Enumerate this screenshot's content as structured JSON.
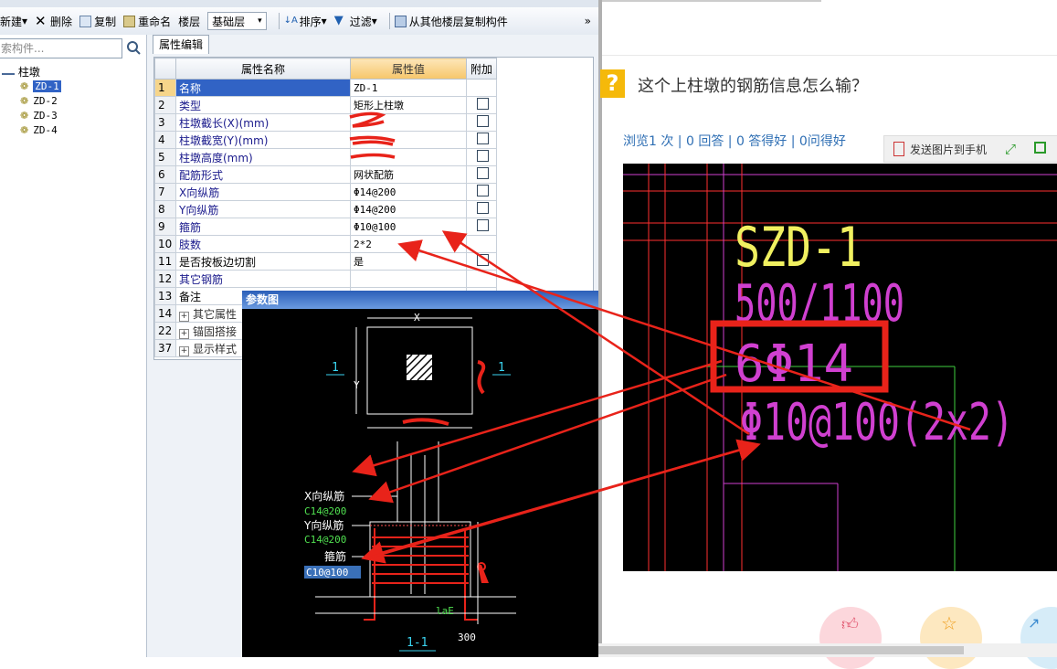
{
  "toolbar": {
    "new_label": "新建",
    "delete_label": "删除",
    "copy_label": "复制",
    "rename_label": "重命名",
    "floor_label": "楼层",
    "floor_value": "基础层",
    "sort_label": "排序",
    "filter_label": "过滤",
    "copy_from_floor_label": "从其他楼层复制构件",
    "more_label": "»"
  },
  "left_pane": {
    "search_placeholder": "索构件...",
    "tree_root": "柱墩",
    "tree_items": [
      "ZD-1",
      "ZD-2",
      "ZD-3",
      "ZD-4"
    ],
    "selected_index": 0
  },
  "property_panel": {
    "tab_label": "属性编辑",
    "headers": {
      "name": "属性名称",
      "value": "属性值",
      "extra": "附加"
    },
    "rows": [
      {
        "num": "1",
        "name": "名称",
        "value": "ZD-1",
        "check": false
      },
      {
        "num": "2",
        "name": "类型",
        "value": "矩形上柱墩",
        "check": true
      },
      {
        "num": "3",
        "name": "柱墩截长(X)(mm)",
        "value": "",
        "check": true
      },
      {
        "num": "4",
        "name": "柱墩截宽(Y)(mm)",
        "value": "",
        "check": true
      },
      {
        "num": "5",
        "name": "柱墩高度(mm)",
        "value": "",
        "check": true
      },
      {
        "num": "6",
        "name": "配筋形式",
        "value": "网状配筋",
        "check": true
      },
      {
        "num": "7",
        "name": "X向纵筋",
        "value": "Φ14@200",
        "check": true
      },
      {
        "num": "8",
        "name": "Y向纵筋",
        "value": "Φ14@200",
        "check": true
      },
      {
        "num": "9",
        "name": "箍筋",
        "value": "Φ10@100",
        "check": true
      },
      {
        "num": "10",
        "name": "肢数",
        "value": "2*2",
        "check": false
      },
      {
        "num": "11",
        "name": "是否按板边切割",
        "value": "是",
        "check": true
      },
      {
        "num": "12",
        "name": "其它钢筋",
        "value": "",
        "check": false
      },
      {
        "num": "13",
        "name": "备注",
        "value": "",
        "check": false
      },
      {
        "num": "14",
        "name": "其它属性",
        "value": "",
        "check": false
      },
      {
        "num": "22",
        "name": "锚固搭接",
        "value": "",
        "check": false
      },
      {
        "num": "37",
        "name": "显示样式",
        "value": "",
        "check": false
      }
    ]
  },
  "param_window": {
    "title": "参数图",
    "x_label": "X",
    "y_label": "Y",
    "section_mark": "1",
    "x_rebar_label": "X向纵筋",
    "x_rebar_value": "C14@200",
    "y_rebar_label": "Y向纵筋",
    "y_rebar_value": "C14@200",
    "stirrup_label": "箍筋",
    "stirrup_value": "C10@100",
    "lae_label": "laE",
    "dim_300": "300",
    "section_title": "1-1"
  },
  "browser": {
    "question_icon": "?",
    "question_title": "这个上柱墩的钢筋信息怎么输？",
    "stats": "浏览1 次 | 0 回答 | 0 答得好 | 0问得好",
    "send_to_phone": "发送图片到手机",
    "cad_text": {
      "name": "SZD-1",
      "size": "500/1100",
      "main_bars": "6Φ14",
      "stirrups": "Φ10@100(2x2)"
    }
  },
  "colors": {
    "annotation_red": "#e8231a",
    "cad_yellow": "#f0f060",
    "cad_magenta": "#d040d0",
    "link_blue": "#2f6fb4",
    "question_orange": "#f5b90a"
  }
}
